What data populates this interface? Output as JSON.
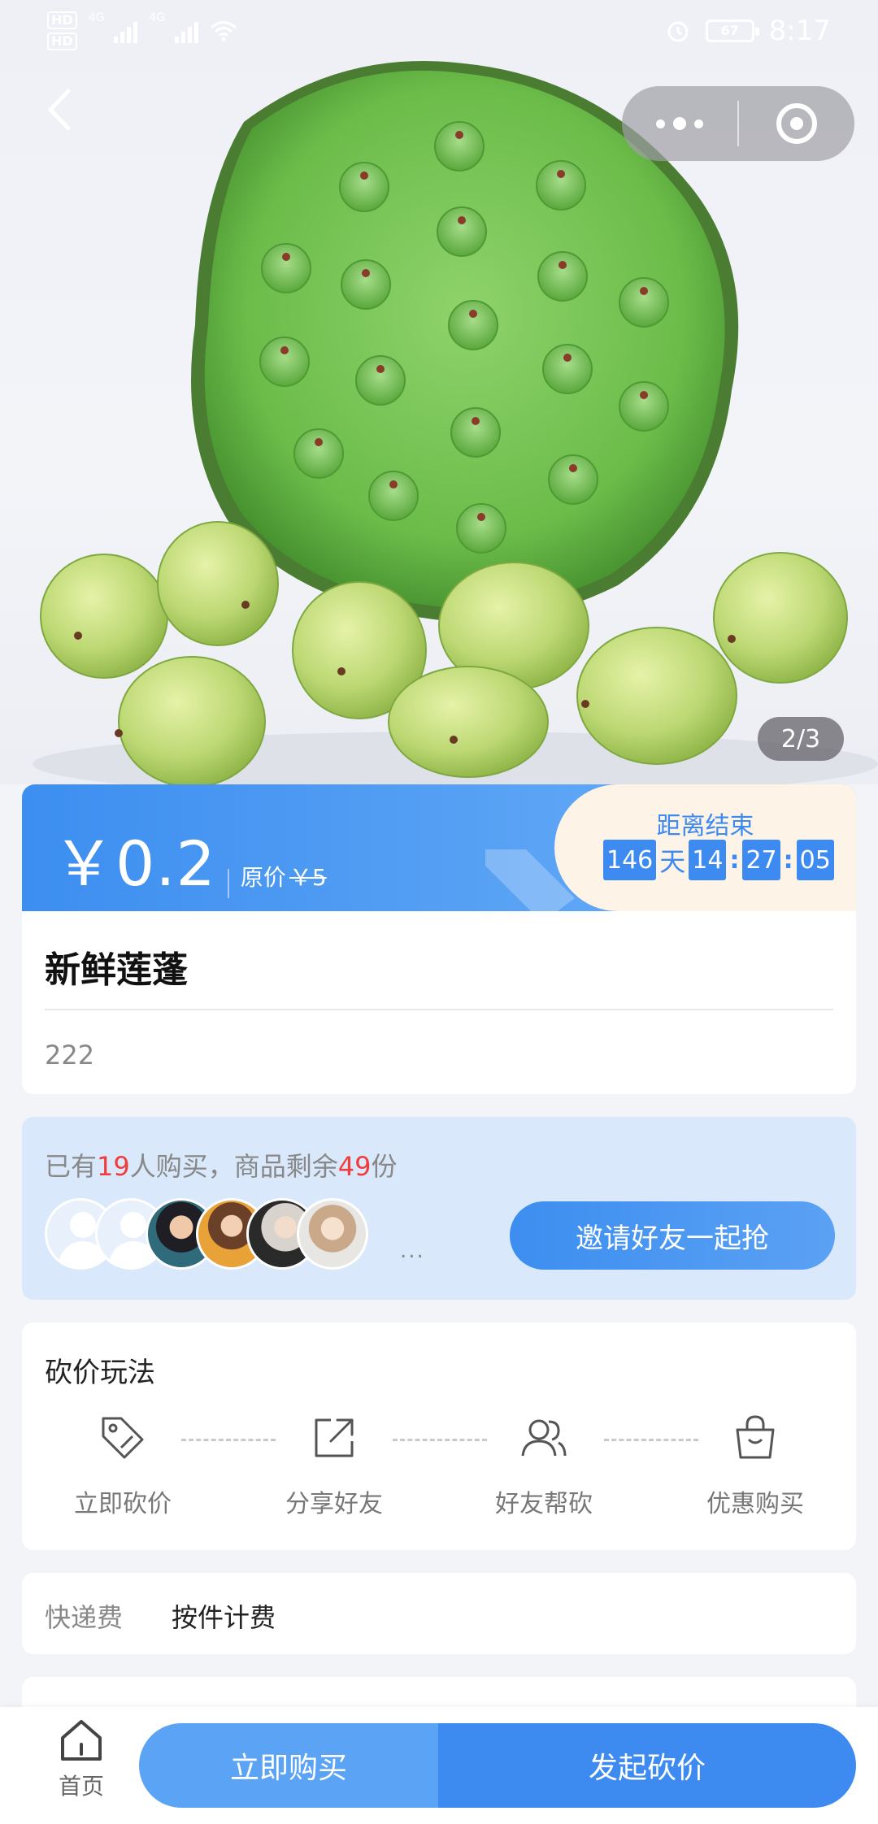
{
  "status_bar": {
    "network_hd": "HD",
    "network_4g": "4G",
    "battery": "67",
    "time": "8:17"
  },
  "hero": {
    "image_counter": "2/3"
  },
  "price": {
    "current": "￥0.2",
    "original_label": "原价",
    "original_value": "￥5"
  },
  "countdown": {
    "label": "距离结束",
    "days": "146",
    "days_unit": "天",
    "hours": "14",
    "minutes": "27",
    "seconds": "05",
    "colon": ":"
  },
  "product": {
    "name": "新鲜莲蓬",
    "description": "222"
  },
  "buyers": {
    "prefix": "已有",
    "count": "19",
    "middle": "人购买，商品剩余",
    "remaining": "49",
    "suffix": "份",
    "more": "...",
    "invite_label": "邀请好友一起抢"
  },
  "rules": {
    "title": "砍价玩法",
    "steps": [
      {
        "label": "立即砍价",
        "icon": "tag-icon"
      },
      {
        "label": "分享好友",
        "icon": "share-icon"
      },
      {
        "label": "好友帮砍",
        "icon": "friends-icon"
      },
      {
        "label": "优惠购买",
        "icon": "shopping-bag-icon"
      }
    ]
  },
  "shipping": {
    "label": "快递费",
    "value": "按件计费"
  },
  "bottom_bar": {
    "home_label": "首页",
    "buy_now_label": "立即购买",
    "bargain_label": "发起砍价"
  },
  "colors": {
    "primary": "#3d8bf0",
    "highlight_red": "#f03c3c",
    "countdown_bg": "#fdf3e7"
  }
}
